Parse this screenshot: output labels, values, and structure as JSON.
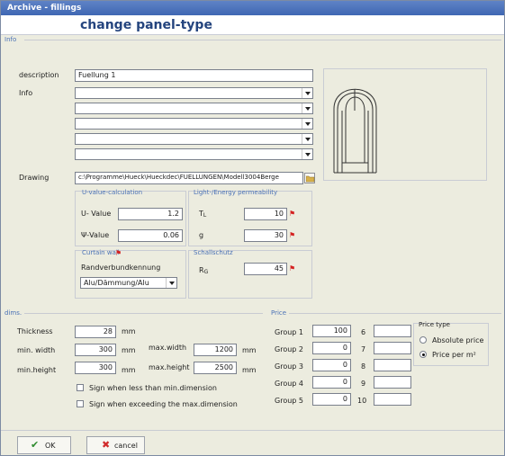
{
  "window": {
    "title": "Archive - fillings"
  },
  "header": {
    "title": "change panel-type"
  },
  "info_section": {
    "title": "Info",
    "description_label": "description",
    "description_value": "Fuellung 1",
    "info_label": "Info",
    "drawing_label": "Drawing",
    "drawing_value": "c:\\Programme\\Hueck\\Hueckdec\\FUELLUNGEN\\Modell3004Berge"
  },
  "u_value": {
    "title": "U-value-calculation",
    "u_label": "U- Value",
    "u_value": "1.2",
    "psi_label": "Ψ-Value",
    "psi_value": "0.06"
  },
  "light": {
    "title": "Light-/Energy permeability",
    "tl_label": "T",
    "tl_sub": "L",
    "tl_value": "10",
    "g_label": "g",
    "g_value": "30"
  },
  "curtain": {
    "title": "Curtain wall",
    "randverbund_label": "Randverbundkennung",
    "randverbund_value": "Alu/Dämmung/Alu"
  },
  "sound": {
    "title": "Schallschutz",
    "rg_label": "R",
    "rg_sub": "G",
    "rg_value": "45"
  },
  "dims": {
    "title": "dims.",
    "thickness_label": "Thickness",
    "thickness_value": "28",
    "unit_mm": "mm",
    "min_width_label": "min. width",
    "min_width_value": "300",
    "max_width_label": "max.width",
    "max_width_value": "1200",
    "min_height_label": "min.height",
    "min_height_value": "300",
    "max_height_label": "max.height",
    "max_height_value": "2500",
    "sign_less_label": "Sign when less than min.dimension",
    "sign_exceed_label": "Sign when exceeding the max.dimension"
  },
  "price": {
    "title": "Price",
    "groups": [
      {
        "label": "Group 1",
        "value": "100",
        "num": "6",
        "value2": ""
      },
      {
        "label": "Group 2",
        "value": "0",
        "num": "7",
        "value2": ""
      },
      {
        "label": "Group 3",
        "value": "0",
        "num": "8",
        "value2": ""
      },
      {
        "label": "Group 4",
        "value": "0",
        "num": "9",
        "value2": ""
      },
      {
        "label": "Group 5",
        "value": "0",
        "num": "10",
        "value2": ""
      }
    ],
    "type_title": "Price type",
    "absolute_label": "Absolute price",
    "per_m2_label": "Price per m²"
  },
  "buttons": {
    "ok": "OK",
    "cancel": "cancel"
  },
  "colors": {
    "title_bar": "#4b70b8",
    "heading": "#24447e",
    "section": "#4b72b6",
    "marker": "#d42020"
  }
}
